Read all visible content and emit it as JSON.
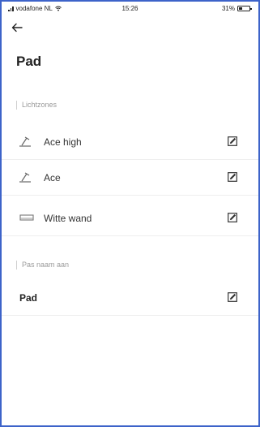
{
  "status_bar": {
    "carrier": "vodafone NL",
    "time": "15:26",
    "battery": "31%"
  },
  "header": {
    "title": "Pad"
  },
  "lightzones": {
    "section_label": "Lichtzones",
    "items": [
      {
        "label": "Ace high",
        "icon": "floor-lamp-icon"
      },
      {
        "label": "Ace",
        "icon": "floor-lamp-icon"
      },
      {
        "label": "Witte wand",
        "icon": "lightbar-icon"
      }
    ]
  },
  "rename": {
    "section_label": "Pas naam aan",
    "value": "Pad"
  },
  "colors": {
    "frame_border": "#3d63c9",
    "text": "#222222",
    "muted": "#9a9a9a"
  }
}
